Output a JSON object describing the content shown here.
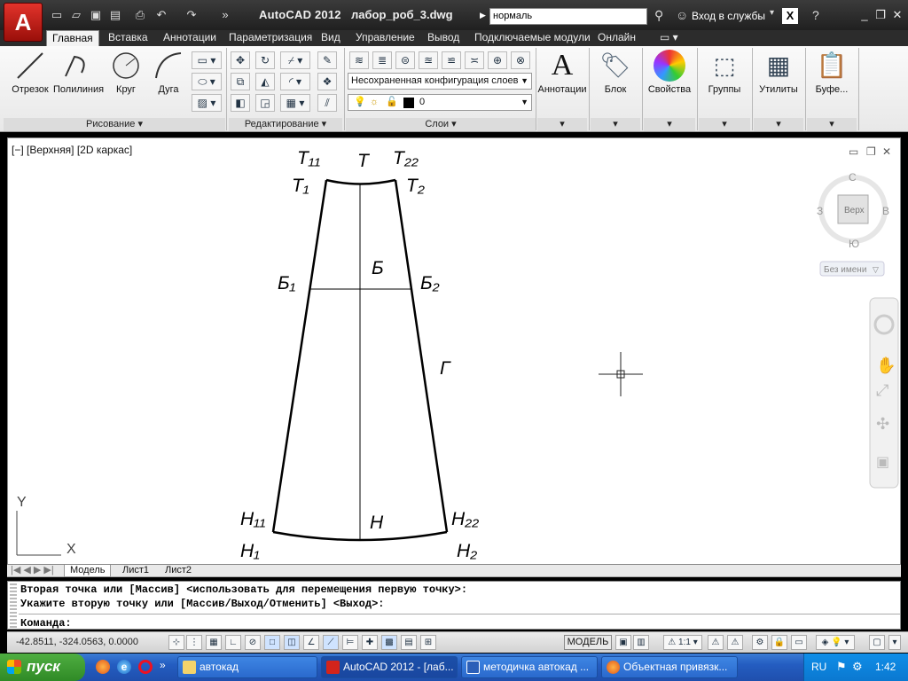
{
  "titlebar": {
    "app_name": "AutoCAD 2012",
    "file_name": "лабор_роб_3.dwg",
    "workspace": "нормаль",
    "sign_in": "Вход в службы",
    "app_menu_icon": "autocad-logo-icon"
  },
  "tabs": [
    "Главная",
    "Вставка",
    "Аннотации",
    "Параметризация",
    "Вид",
    "Управление",
    "Вывод",
    "Подключаемые модули",
    "Онлайн"
  ],
  "ribbon": {
    "draw": {
      "tools": [
        "Отрезок",
        "Полилиния",
        "Круг",
        "Дуга"
      ],
      "label": "Рисование"
    },
    "modify": {
      "label": "Редактирование"
    },
    "layers": {
      "config": "Несохраненная конфигурация слоев",
      "current": "0",
      "label": "Слои"
    },
    "big_panels": [
      "Аннотации",
      "Блок",
      "Свойства",
      "Группы",
      "Утилиты",
      "Буфе..."
    ]
  },
  "viewport": {
    "label": "[−] [Верхняя] [2D каркас]",
    "viewcube": {
      "n": "С",
      "s": "Ю",
      "w": "З",
      "e": "В",
      "face": "Верх",
      "ucs": "Без имени"
    },
    "drawing_labels": {
      "t11": "Т₁₁",
      "t": "Т",
      "t22": "Т₂₂",
      "t1": "Т₁",
      "t2": "Т₂",
      "b1": "Б₁",
      "b": "Б",
      "b2": "Б₂",
      "g": "Г",
      "h11": "Н₁₁",
      "h": "Н",
      "h22": "Н₂₂",
      "h1": "Н₁",
      "h2": "Н₂"
    },
    "axis_x": "X",
    "axis_y": "Y"
  },
  "layout_tabs": [
    "Модель",
    "Лист1",
    "Лист2"
  ],
  "command": {
    "line1": "Вторая точка или [Массив] <использовать для перемещения первую точку>:",
    "line2": "Укажите вторую точку или [Массив/Выход/Отменить] <Выход>:",
    "prompt": "Команда:"
  },
  "statusbar": {
    "coords": "-42.8511, -324.0563, 0.0000",
    "model": "МОДЕЛЬ",
    "scale": "1:1"
  },
  "taskbar": {
    "start": "пуск",
    "tasks": [
      "автокад",
      "AutoCAD 2012 - [лаб...",
      "методичка автокад ...",
      "Объектная привязк..."
    ],
    "lang": "RU",
    "time": "1:42"
  }
}
